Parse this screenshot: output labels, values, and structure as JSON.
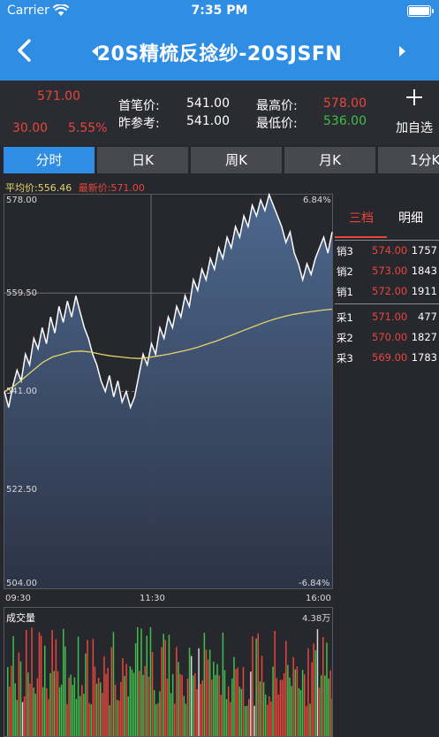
{
  "status_bar": {
    "carrier": "Carrier",
    "time": "7:35 PM"
  },
  "nav": {
    "title": "20S精梳反捻纱-20SJSFN"
  },
  "quote": {
    "last_price": "571.00",
    "change": "30.00",
    "change_pct": "5.55%",
    "first_label": "首笔价:",
    "first_value": "541.00",
    "prev_label": "昨参考:",
    "prev_value": "541.00",
    "high_label": "最高价:",
    "high_value": "578.00",
    "low_label": "最低价:",
    "low_value": "536.00",
    "add_watch": "加自选"
  },
  "tabs": [
    "分时",
    "日K",
    "周K",
    "月K",
    "1分K"
  ],
  "summary": {
    "avg_text": "平均价:556.46",
    "latest_text": "最新价:571.00"
  },
  "chart_data": {
    "type": "line",
    "y_ticks": [
      "578.00",
      "559.50",
      "541.00",
      "522.50",
      "504.00"
    ],
    "pct_top": "6.84%",
    "pct_bottom": "-6.84%",
    "x_ticks": [
      "09:30",
      "11:30",
      "16:00"
    ],
    "ylim": [
      504,
      578
    ],
    "series": [
      {
        "values": [
          541,
          538,
          542,
          545,
          543,
          548,
          546,
          551,
          549,
          553,
          550,
          555,
          552,
          557,
          554,
          558,
          555,
          559,
          556,
          553,
          551,
          548,
          546,
          543,
          541,
          544,
          540,
          543,
          539,
          541,
          538,
          540,
          544,
          548,
          546,
          550,
          548,
          553,
          551,
          555,
          553,
          557,
          555,
          559,
          557,
          562,
          560,
          564,
          562,
          566,
          564,
          568,
          566,
          570,
          568,
          572,
          570,
          574,
          572,
          576,
          574,
          577,
          575,
          578,
          576,
          574,
          572,
          569,
          571,
          567,
          565,
          562,
          565,
          563,
          566,
          568,
          570,
          567,
          571
        ]
      },
      {
        "values": [
          541,
          542,
          543.5,
          545,
          546.5,
          547.5,
          548,
          548.5,
          548.6,
          548.4,
          548,
          547.7,
          547.5,
          547.3,
          547.2,
          547.4,
          547.7,
          548,
          548.4,
          548.8,
          549.3,
          549.9,
          550.5,
          551.2,
          551.9,
          552.6,
          553.3,
          554,
          554.6,
          555.1,
          555.5,
          555.8,
          556.05,
          556.3,
          556.46
        ]
      }
    ],
    "volume_label": "成交量",
    "volume_max": "4.38万"
  },
  "book": {
    "tabs": [
      "三档",
      "明细"
    ],
    "asks": [
      {
        "label": "销3",
        "price": "574.00",
        "qty": "1757"
      },
      {
        "label": "销2",
        "price": "573.00",
        "qty": "1843"
      },
      {
        "label": "销1",
        "price": "572.00",
        "qty": "1911"
      }
    ],
    "bids": [
      {
        "label": "采1",
        "price": "571.00",
        "qty": "477"
      },
      {
        "label": "采2",
        "price": "570.00",
        "qty": "1827"
      },
      {
        "label": "采3",
        "price": "569.00",
        "qty": "1783"
      }
    ]
  },
  "colors": {
    "nav": "#2f8de4",
    "up": "#e8463b",
    "down": "#3fbf4a",
    "avg": "#e6d36b"
  }
}
